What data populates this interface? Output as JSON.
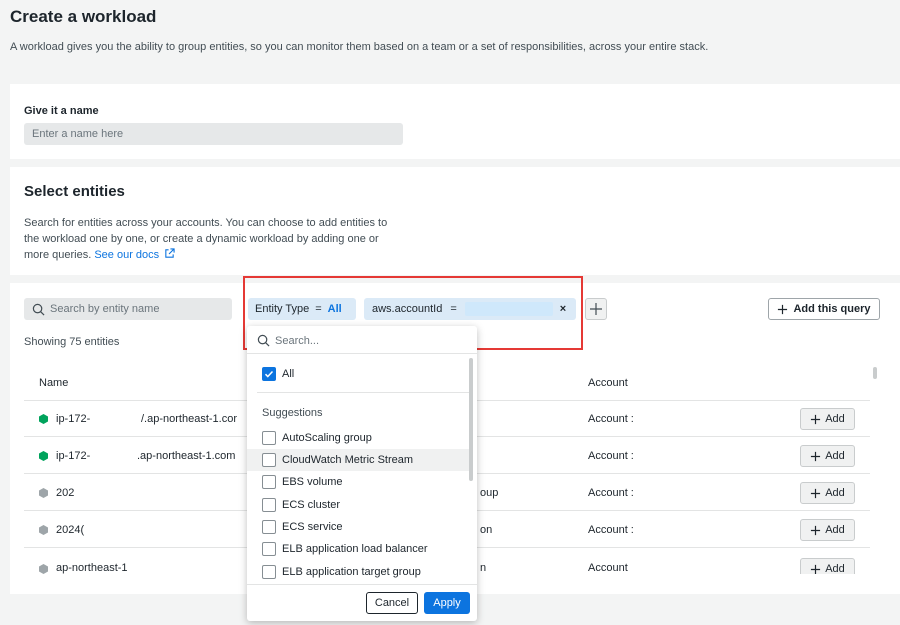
{
  "page": {
    "title": "Create a workload",
    "description": "A workload gives you the ability to group entities, so you can monitor them based on a team or a set of responsibilities, across your entire stack."
  },
  "name_section": {
    "label": "Give it a name",
    "placeholder": "Enter a name here"
  },
  "entities_section": {
    "title": "Select entities",
    "description": "Search for entities across your accounts. You can choose to add entities to the workload one by one, or create a dynamic workload by adding one or more queries.",
    "docs_link": "See our docs"
  },
  "list": {
    "search_placeholder": "Search by entity name",
    "showing": "Showing 75 entities",
    "add_query_label": "Add this query",
    "columns": {
      "name": "Name",
      "account": "Account"
    },
    "rows": [
      {
        "name": "ip-172-",
        "name2": "/.ap-northeast-1.cor",
        "type": "",
        "account": "Account :",
        "status_color": "#00a35c"
      },
      {
        "name": "ip-172-",
        "name2": ".ap-northeast-1.com",
        "type": "",
        "account": "Account :",
        "status_color": "#00a35c"
      },
      {
        "name": "202",
        "name2": "",
        "type": "oup",
        "account": "Account :",
        "status_color": "#9ea5a9"
      },
      {
        "name": "2024(",
        "name2": "",
        "type": "on",
        "account": "Account :",
        "status_color": "#9ea5a9"
      },
      {
        "name": "ap-northeast-1",
        "name2": "",
        "type": "n",
        "account": "Account",
        "status_color": "#9ea5a9"
      }
    ],
    "add_label": "Add"
  },
  "query": {
    "chip1": {
      "key": "Entity Type",
      "op": "=",
      "value": "All"
    },
    "chip2": {
      "key": "aws.accountId",
      "op": "=",
      "remove": "×"
    }
  },
  "dropdown": {
    "search_placeholder": "Search...",
    "all_label": "All",
    "suggestions_label": "Suggestions",
    "items": [
      "AutoScaling group",
      "CloudWatch Metric Stream",
      "EBS volume",
      "ECS cluster",
      "ECS service",
      "ELB application load balancer",
      "ELB application target group"
    ],
    "cancel_label": "Cancel",
    "apply_label": "Apply"
  },
  "colors": {
    "accent": "#0c74df",
    "highlight": "#e53935",
    "healthy": "#00a35c"
  }
}
